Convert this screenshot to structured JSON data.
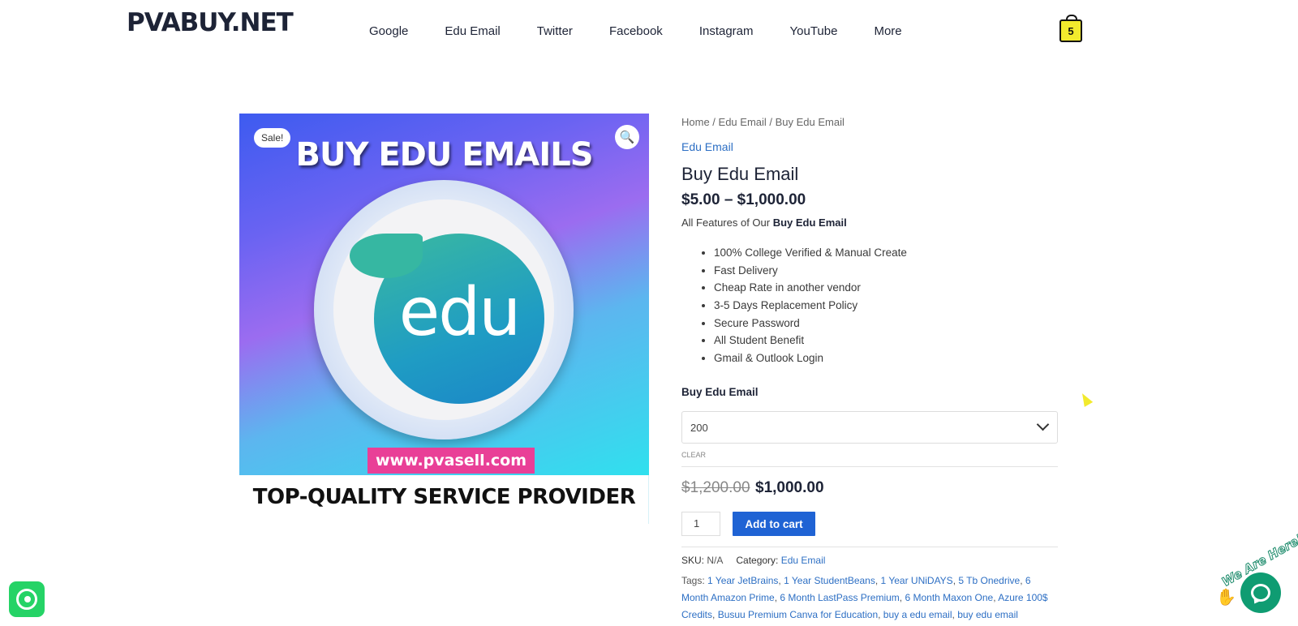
{
  "header": {
    "logo": "PVABUY.NET",
    "nav": [
      "Google",
      "Edu Email",
      "Twitter",
      "Facebook",
      "Instagram",
      "YouTube",
      "More"
    ],
    "cart_count": "5"
  },
  "image": {
    "sale_badge": "Sale!",
    "zoom_icon": "search-icon",
    "headline": "BUY EDU EMAILS",
    "logo_word": "edu",
    "url": "www.pvasell.com",
    "bottom_line": "TOP-QUALITY SERVICE PROVIDER"
  },
  "breadcrumb": {
    "home": "Home",
    "sep1": " / ",
    "cat": "Edu Email",
    "sep2": " / ",
    "current": "Buy Edu Email"
  },
  "product": {
    "category": "Edu Email",
    "title": "Buy Edu Email",
    "price_range": "$5.00 – $1,000.00",
    "features_prefix": "All Features of Our ",
    "features_bold": "Buy Edu  Email",
    "features": [
      "100% College Verified & Manual Create",
      "Fast Delivery",
      "Cheap Rate in another vendor",
      "3-5 Days Replacement Policy",
      "Secure Password",
      "All Student Benefit",
      "Gmail & Outlook Login"
    ],
    "variation_label": "Buy Edu Email",
    "variation_value": "200",
    "clear": "CLEAR",
    "old_price": "$1,200.00",
    "new_price": "$1,000.00",
    "qty": "1",
    "add_to_cart": "Add to cart"
  },
  "meta": {
    "sku_label": "SKU: ",
    "sku": "N/A",
    "category_label": "Category: ",
    "category": "Edu Email",
    "tags_label": "Tags: ",
    "tags": [
      "1 Year JetBrains",
      "1 Year StudentBeans",
      "1 Year UNiDAYS",
      "5 Tb Onedrive",
      "6 Month Amazon Prime",
      "6 Month LastPass Premium",
      "6 Month Maxon One",
      "Azure 100$ Credits",
      "Busuu Premium Canva for Education",
      "buy a edu email",
      "buy edu email"
    ]
  },
  "chat": {
    "tagline": "We Are Here!"
  },
  "colors": {
    "brand_blue": "#1f63d4",
    "cart_yellow": "#f2ea2d",
    "whatsapp": "#25d366",
    "chat_green": "#0f9c72"
  }
}
